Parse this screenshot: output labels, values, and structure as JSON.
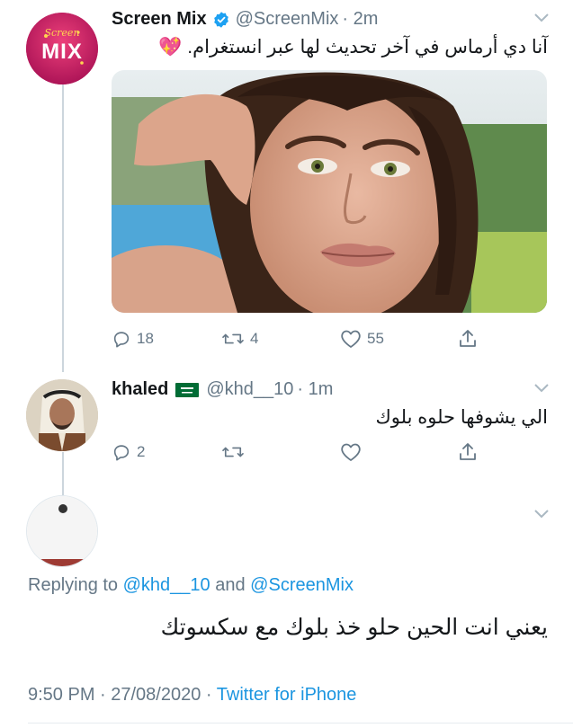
{
  "tweet1": {
    "name": "Screen Mix",
    "handle": "@ScreenMix",
    "time": "· 2m",
    "text": "آنا دي أرماس في آخر تحديث لها عبر انستغرام. 💖",
    "avatar_logo_text": "MIX",
    "avatar_logo_script": "Screen",
    "actions": {
      "replies": "18",
      "retweets": "4",
      "likes": "55"
    }
  },
  "tweet2": {
    "name": "khaled",
    "flag": "🇸🇦",
    "handle": "@khd__10",
    "time": "· 1m",
    "text": "الي يشوفها حلوه بلوك",
    "actions": {
      "replies": "2"
    }
  },
  "tweet3": {
    "replying_prefix": "Replying to",
    "reply_user1": "@khd__10",
    "reply_and": "and",
    "reply_user2": "@ScreenMix",
    "text": "يعني انت الحين حلو خذ بلوك مع سكسوتك",
    "timestamp": "9:50 PM · 27/08/2020 ·",
    "source": "Twitter for iPhone"
  },
  "colors": {
    "accent": "#1b95e0",
    "muted": "#657786",
    "thread_line": "#ccd6dd",
    "verified": "#1da1f2",
    "logo_bg": "#c2185b"
  },
  "icons": [
    "reply-icon",
    "retweet-icon",
    "like-icon",
    "share-icon",
    "verified-badge-icon",
    "chevron-down-icon"
  ]
}
